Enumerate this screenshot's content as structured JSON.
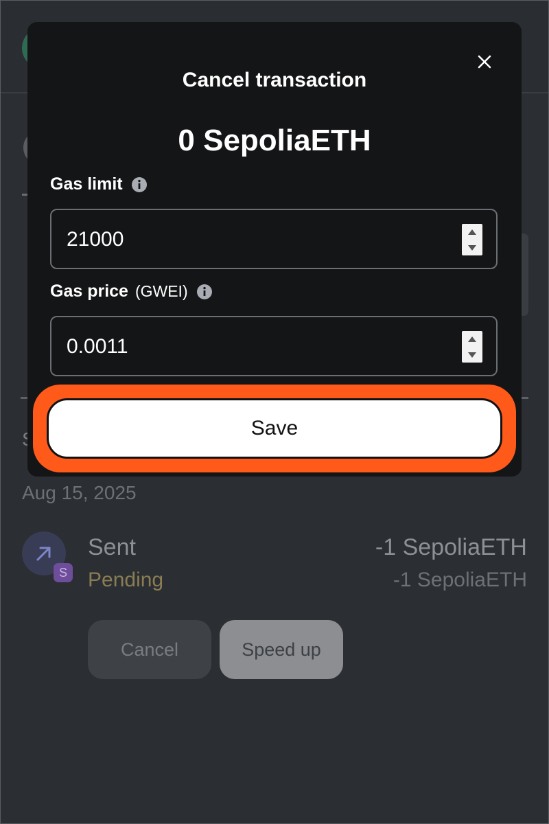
{
  "background": {
    "section_letter": "S",
    "date": "Aug 15, 2025",
    "transaction": {
      "title": "Sent",
      "status": "Pending",
      "amount": "-1 SepoliaETH",
      "amount_secondary": "-1 SepoliaETH",
      "badge_letter": "S",
      "icon": "arrow-up-right-icon"
    },
    "cancel_label": "Cancel",
    "speed_up_label": "Speed up"
  },
  "modal": {
    "title": "Cancel transaction",
    "amount": "0 SepoliaETH",
    "gas_limit": {
      "label": "Gas limit",
      "value": "21000"
    },
    "gas_price": {
      "label": "Gas price",
      "unit": "(GWEI)",
      "value": "0.0011"
    },
    "save_label": "Save"
  },
  "colors": {
    "highlight_ring": "#ff5a1a",
    "modal_bg": "#141517",
    "page_bg": "#2b2e33",
    "pending": "#8a7d53"
  }
}
